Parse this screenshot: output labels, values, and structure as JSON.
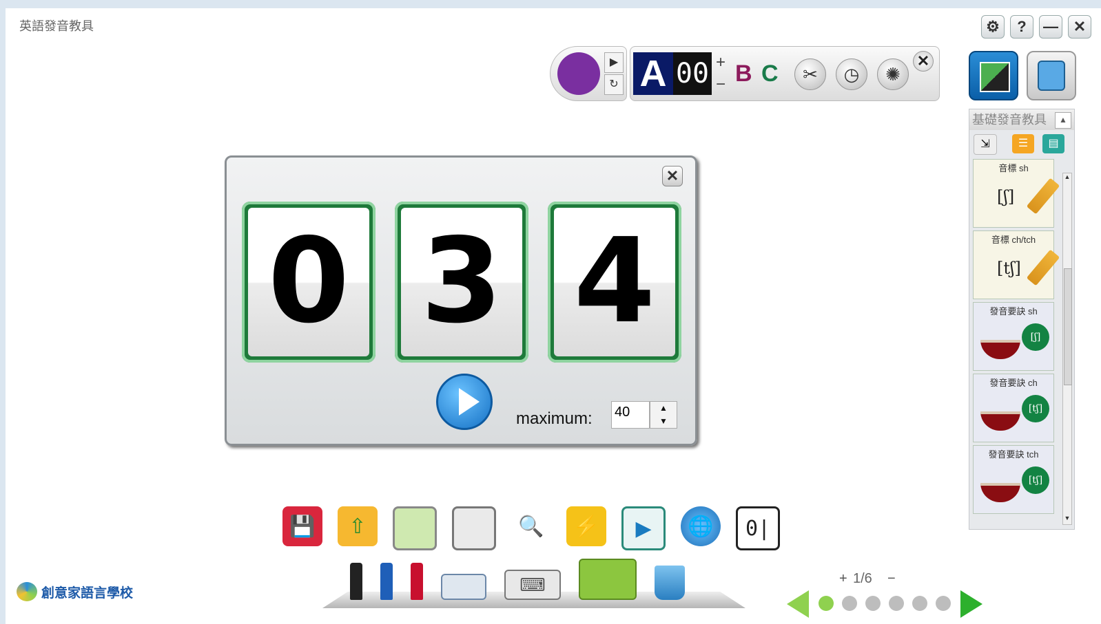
{
  "app": {
    "title": "英語發音教具"
  },
  "window_controls": {
    "settings": "⚙",
    "help": "?",
    "minimize": "—",
    "close": "✕"
  },
  "toolbar": {
    "pen_color": "#7a2fa0",
    "play_glyph": "▶",
    "reload_glyph": "↻",
    "font_A": "A",
    "size_value": "00",
    "plus": "+",
    "minus": "−",
    "font_B": "B",
    "font_C": "C",
    "tools_icon": "✂",
    "clock_icon": "◷",
    "sparkle_icon": "✺",
    "close": "✕"
  },
  "side_panel": {
    "title": "基礎發音教具",
    "collapse": "▲",
    "items": [
      {
        "label": "音標 sh",
        "ipa": "[ʃ]",
        "kind": "pencil"
      },
      {
        "label": "音標 ch/tch",
        "ipa": "[tʃ]",
        "kind": "pencil"
      },
      {
        "label": "發音要訣 sh",
        "ipa": "[ʃ]",
        "kind": "sound"
      },
      {
        "label": "發音要訣 ch",
        "ipa": "[tʃ]",
        "kind": "sound"
      },
      {
        "label": "發音要訣 tch",
        "ipa": "[tʃ]",
        "kind": "sound"
      }
    ]
  },
  "counter": {
    "digits": [
      "0",
      "3",
      "4"
    ],
    "close": "✕",
    "maximum_label": "maximum:",
    "maximum_value": "40",
    "spin_up": "▲",
    "spin_down": "▼"
  },
  "bottom_tools": {
    "icons": [
      "save-icon",
      "open-folder-icon",
      "whiteboard-icon",
      "screen-icon",
      "magnifier-icon",
      "flashlight-icon",
      "media-icon",
      "web-link-icon",
      "counter-icon"
    ],
    "shelf": [
      "black-marker-icon",
      "blue-marker-icon",
      "red-marker-icon",
      "eraser-icon",
      "keyboard-icon",
      "toolbox-icon",
      "trash-icon"
    ]
  },
  "logo": {
    "text": "創意家語言學校"
  },
  "pager": {
    "current": "1/6",
    "plus": "+",
    "minus": "−",
    "total_dots": 6,
    "active_index": 0
  }
}
